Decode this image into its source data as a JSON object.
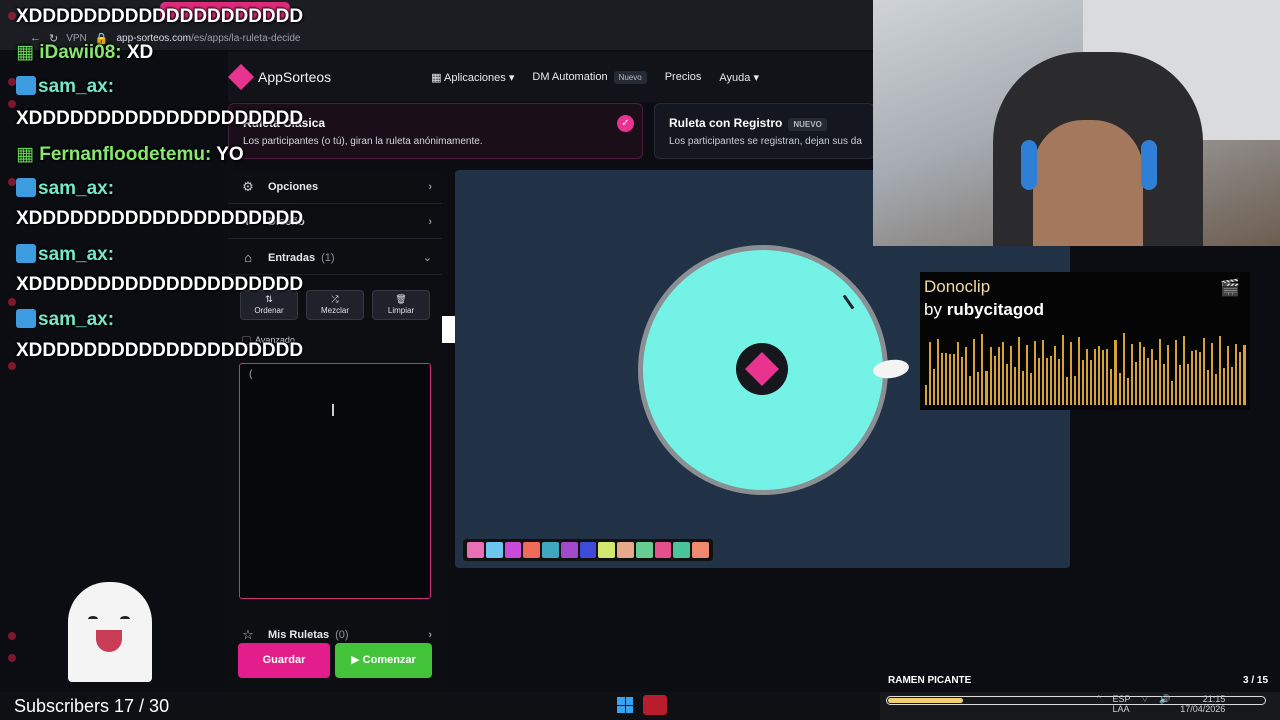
{
  "browser": {
    "url_host": "app-sorteos.com",
    "url_path": "/es/apps/la-ruleta-decide",
    "vpn": "VPN"
  },
  "header": {
    "brand": "AppSorteos",
    "nav": [
      {
        "label": "Aplicaciones",
        "has_dropdown": true
      },
      {
        "label": "DM Automation",
        "badge": "Nuevo"
      },
      {
        "label": "Precios"
      },
      {
        "label": "Ayuda",
        "has_dropdown": true
      }
    ]
  },
  "modes": {
    "classic": {
      "title": "Ruleta Clásica",
      "desc": "Los participantes (o tú), giran la ruleta anónimamente.",
      "selected": true
    },
    "registro": {
      "title": "Ruleta con Registro",
      "badge": "NUEVO",
      "desc": "Los participantes se registran, dejan sus da"
    }
  },
  "panel": {
    "opciones": "Opciones",
    "diseno": "Diseño",
    "entradas": "Entradas",
    "entradas_count": "(1)",
    "tools": {
      "ordenar": "Ordenar",
      "mezclar": "Mezclar",
      "limpiar": "Limpiar"
    },
    "avanzado": "Avanzado",
    "entries_value": "(",
    "mis_ruletas": "Mis Ruletas",
    "mis_ruletas_count": "(0)",
    "guardar": "Guardar",
    "comenzar": "Comenzar"
  },
  "wheel": {
    "color": "#75f2e6",
    "rim_color": "#8a8f93",
    "hub_color": "#16171c"
  },
  "swatches": [
    "#e96fb7",
    "#6cc6ef",
    "#c94ad9",
    "#f06a5b",
    "#3fa7c0",
    "#a049c9",
    "#3f4bd8",
    "#d4e76e",
    "#e6aa8a",
    "#66cc8f",
    "#e54f8c",
    "#4bc39b",
    "#f1896f"
  ],
  "chat": [
    {
      "message": "XDDDDDDDDDDDDDDDDDDDD"
    },
    {
      "user": "iDawii08:",
      "message": "XD",
      "user_style": "green"
    },
    {
      "user": "sam_ax:"
    },
    {
      "message": "XDDDDDDDDDDDDDDDDDDDD"
    },
    {
      "user": "Fernanfloodetemu:",
      "message": "YO",
      "user_style": "green"
    },
    {
      "user": "sam_ax:"
    },
    {
      "message": "XDDDDDDDDDDDDDDDDDDDD"
    },
    {
      "user": "sam_ax:"
    },
    {
      "message": "XDDDDDDDDDDDDDDDDDDDD"
    },
    {
      "user": "sam_ax:"
    },
    {
      "message": "XDDDDDDDDDDDDDDDDDDDD"
    }
  ],
  "donoclip": {
    "title": "Donoclip",
    "by": "by",
    "user": "rubycitagod"
  },
  "stream": {
    "subs_text": "Subscribers 17 / 30",
    "song": "RAMEN PICANTE",
    "song_count": "3 / 15",
    "song_progress": 0.2
  },
  "tray": {
    "lang": "ESP",
    "layout": "LAA",
    "time": "21:15",
    "date": "17/04/2026"
  }
}
